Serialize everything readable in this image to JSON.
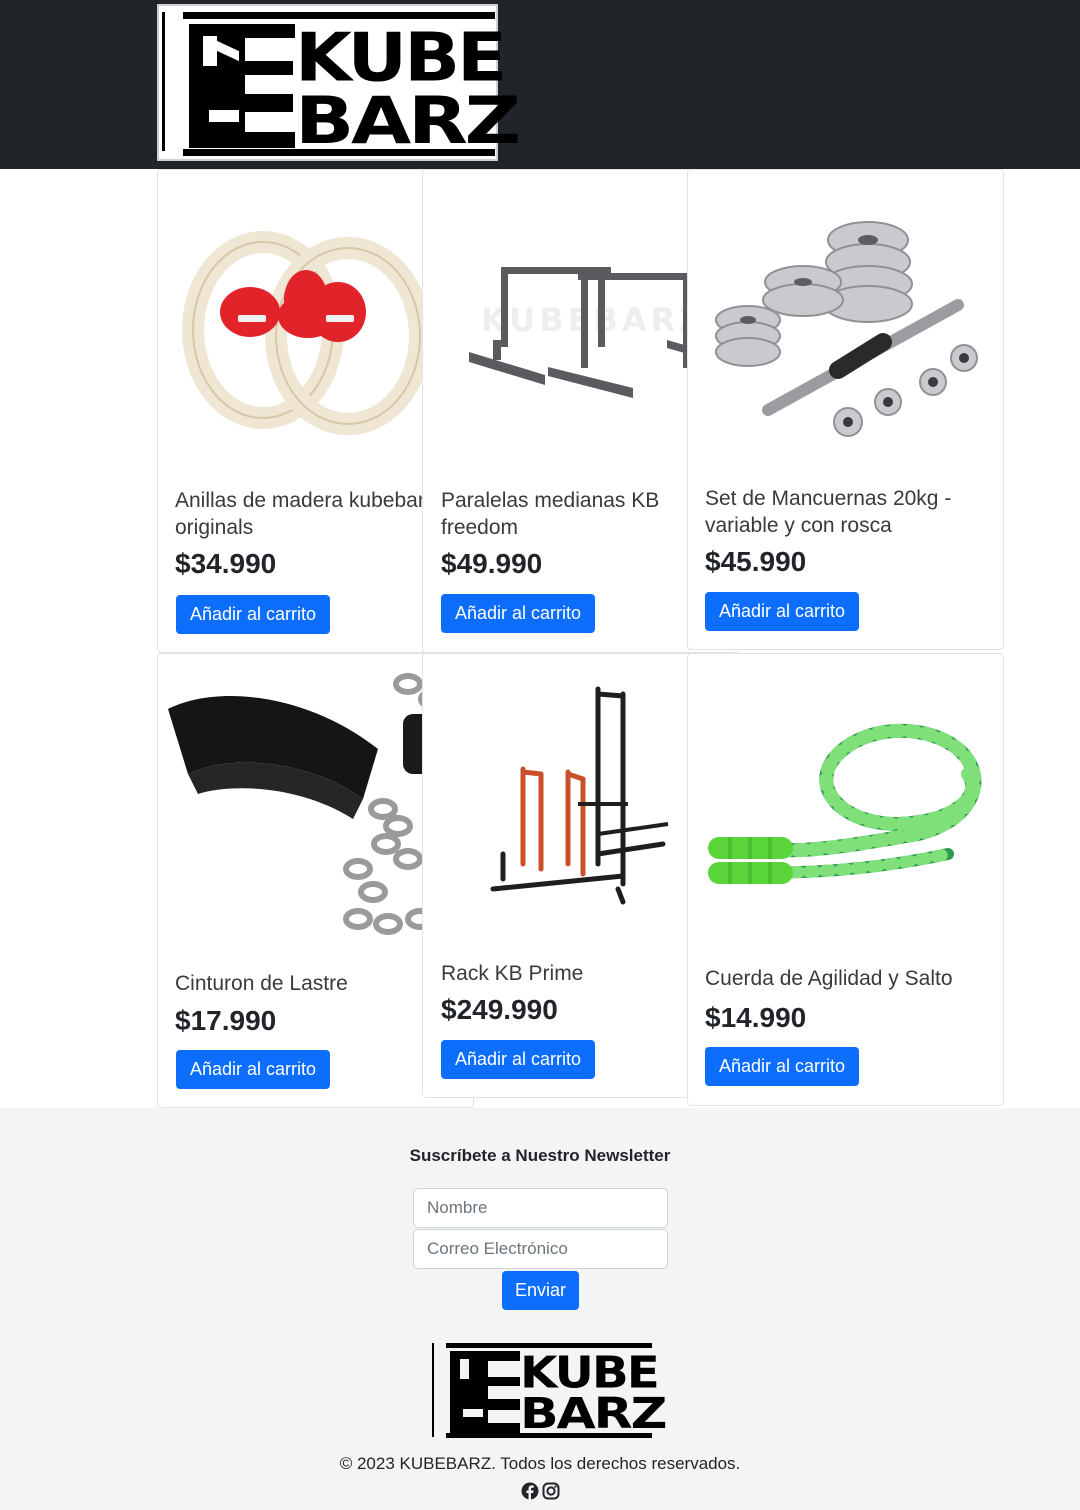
{
  "header": {
    "brand_line1": "KUBE",
    "brand_line2": "BARZ"
  },
  "products": [
    {
      "name": "Anillas de madera kubebarz originals",
      "price": "$34.990",
      "button": "Añadir al carrito"
    },
    {
      "name": "Paralelas medianas KB freedom",
      "price": "$49.990",
      "button": "Añadir al carrito"
    },
    {
      "name": "Set de Mancuernas 20kg - variable y con rosca",
      "price": "$45.990",
      "button": "Añadir al carrito"
    },
    {
      "name": "Cinturon de Lastre",
      "price": "$17.990",
      "button": "Añadir al carrito"
    },
    {
      "name": "Rack KB Prime",
      "price": "$249.990",
      "button": "Añadir al carrito"
    },
    {
      "name": "Cuerda de Agilidad y Salto",
      "price": "$14.990",
      "button": "Añadir al carrito"
    }
  ],
  "product_name_lines": [
    [
      "Anillas de madera kubebarz",
      "originals"
    ],
    [
      "Paralelas medianas KB",
      "freedom"
    ],
    [
      "Set de Mancuernas 20kg -",
      "variable y con rosca"
    ],
    [
      "Cinturon de Lastre"
    ],
    [
      "Rack KB Prime"
    ],
    [
      "Cuerda de Agilidad y Salto"
    ]
  ],
  "image_watermark": "KUBEBARZ",
  "newsletter": {
    "title": "Suscríbete a Nuestro Newsletter",
    "name_placeholder": "Nombre",
    "email_placeholder": "Correo Electrónico",
    "submit_label": "Enviar"
  },
  "footer": {
    "copyright": "© 2023 KUBEBARZ. Todos los derechos reservados.",
    "social_icons": [
      "facebook-icon",
      "instagram-icon"
    ]
  },
  "colors": {
    "header_bg": "#212529",
    "primary": "#0d6efd",
    "footer_bg": "#f4f4f5"
  }
}
